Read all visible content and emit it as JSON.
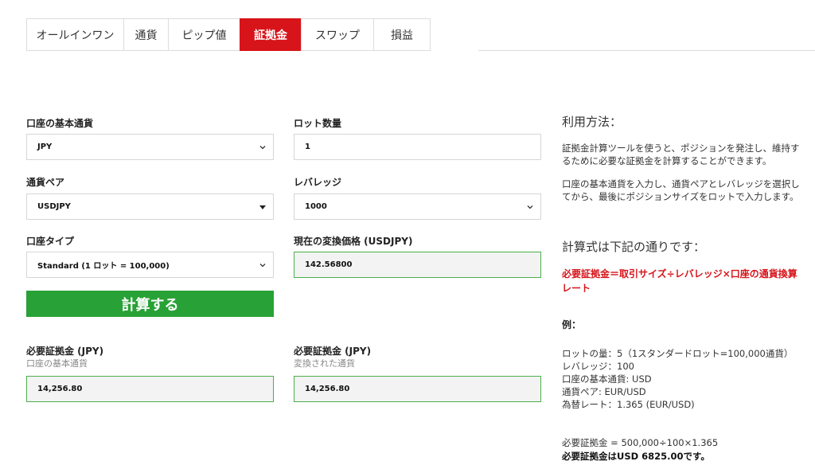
{
  "tabs": [
    {
      "label": "オールインワン",
      "active": false
    },
    {
      "label": "通貨",
      "active": false
    },
    {
      "label": "ピップ値",
      "active": false
    },
    {
      "label": "証拠金",
      "active": true
    },
    {
      "label": "スワップ",
      "active": false
    },
    {
      "label": "損益",
      "active": false
    }
  ],
  "form": {
    "base_currency": {
      "label": "口座の基本通貨",
      "value": "JPY"
    },
    "lot": {
      "label": "ロット数量",
      "value": "1"
    },
    "pair": {
      "label": "通貨ペア",
      "value": "USDJPY"
    },
    "leverage": {
      "label": "レバレッジ",
      "value": "1000"
    },
    "account_type": {
      "label": "口座タイプ",
      "value": "Standard (1 ロット = 100,000)"
    },
    "rate": {
      "label": "現在の変換価格 (USDJPY)",
      "value": "142.56800"
    },
    "calc_button": "計算する",
    "margin_base": {
      "label": "必要証拠金 (JPY)",
      "sublabel": "口座の基本通貨",
      "value": "14,256.80"
    },
    "margin_conv": {
      "label": "必要証拠金 (JPY)",
      "sublabel": "変換された通貨",
      "value": "14,256.80"
    }
  },
  "help": {
    "usage_title": "利用方法：",
    "usage_p1": "証拠金計算ツールを使うと、ポジションを発注し、維持するために必要な証拠金を計算することができます。",
    "usage_p2": "口座の基本通貨を入力し、通貨ペアとレバレッジを選択してから、最後にポジションサイズをロットで入力します。",
    "formula_title": "計算式は下記の通りです：",
    "formula": "必要証拠金＝取引サイズ÷レバレッジ×口座の通貨換算レート",
    "example_title": "例：",
    "example_lines": [
      "ロットの量：5（1スタンダードロット=100,000通貨）",
      "レバレッジ：100",
      "口座の基本通貨: USD",
      "通貨ペア: EUR/USD",
      "為替レート：1.365 (EUR/USD)"
    ],
    "calc_line": "必要証拠金 = 500,000÷100×1.365",
    "result_line": "必要証拠金はUSD 6825.00です。"
  },
  "colors": {
    "accent": "#d7141a",
    "button": "#28a236",
    "output_border": "#4cae4c"
  }
}
